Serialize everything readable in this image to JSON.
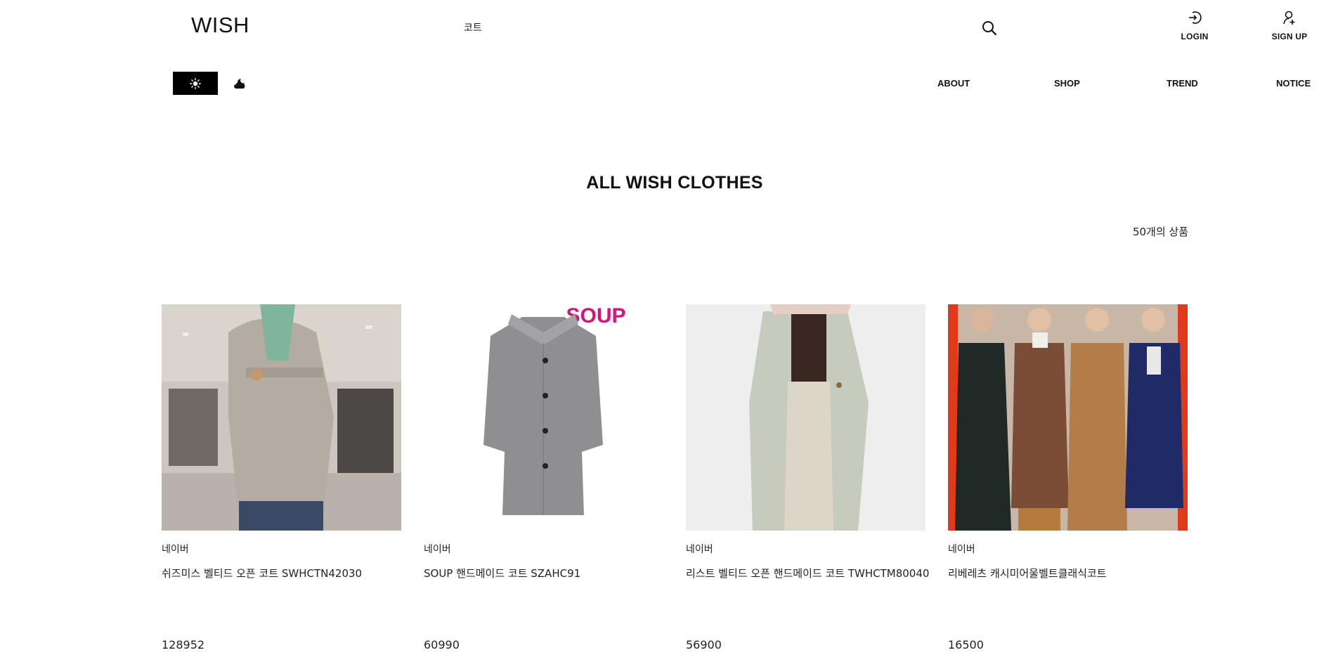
{
  "header": {
    "logo": "WISH",
    "search": {
      "value": "코트"
    },
    "login_label": "LOGIN",
    "signup_label": "SIGN UP"
  },
  "nav": {
    "items": [
      "ABOUT",
      "SHOP",
      "TREND",
      "NOTICE"
    ]
  },
  "theme_toggle": {
    "light_icon": "sun-icon",
    "dark_icon": "cloud-moon-icon",
    "active": "light"
  },
  "main": {
    "title": "ALL WISH CLOTHES",
    "count_label": "50개의 상품"
  },
  "products": [
    {
      "seller": "네이버",
      "name": "쉬즈미스 벨티드 오픈 코트 SWHCTN42030",
      "price": "128952"
    },
    {
      "seller": "네이버",
      "name": "SOUP 핸드메이드 코트 SZAHC91",
      "price": "60990",
      "image_brand_text": "SOUP"
    },
    {
      "seller": "네이버",
      "name": "리스트 벨티드 오픈 핸드메이드 코트 TWHCTM80040",
      "price": "56900"
    },
    {
      "seller": "네이버",
      "name": "리베레츠 캐시미어울벨트클래식코트",
      "price": "16500"
    }
  ],
  "colors": {
    "accent": "#000000",
    "soup_brand": "#d4147a"
  }
}
